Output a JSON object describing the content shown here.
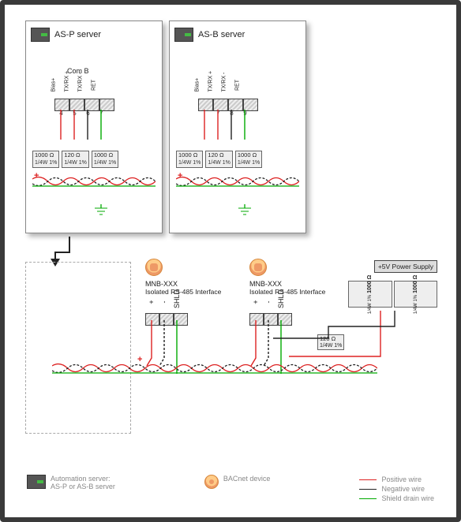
{
  "servers": {
    "asp": {
      "title": "AS-P server",
      "bus_label": "Com B",
      "terminals": {
        "labels": [
          "Bias+",
          "TX/RX +",
          "TX/RX -",
          "RET"
        ],
        "numbers": [
          "4",
          "5",
          "6",
          "7"
        ]
      },
      "resistors": {
        "r1": "1000 Ω",
        "r1_sub": "1/4W 1%",
        "r2": "120 Ω",
        "r2_sub": "1/4W 1%",
        "r3": "1000 Ω",
        "r3_sub": "1/4W 1%"
      }
    },
    "asb": {
      "title": "AS-B server",
      "terminals": {
        "labels": [
          "Bias+",
          "TX/RX +",
          "TX/RX -",
          "RET"
        ],
        "numbers": [
          "7",
          "8",
          "9"
        ]
      },
      "resistors": {
        "r1": "1000 Ω",
        "r1_sub": "1/4W 1%",
        "r2": "120 Ω",
        "r2_sub": "1/4W 1%",
        "r3": "1000 Ω",
        "r3_sub": "1/4W 1%"
      }
    }
  },
  "bacnet": {
    "dev1": {
      "title": "MNB-XXX",
      "sub": "Isolated RS-485 Interface",
      "signs": [
        "+",
        "-",
        "SHLD"
      ]
    },
    "dev2": {
      "title": "MNB-XXX",
      "sub": "Isolated RS-485 Interface",
      "signs": [
        "+",
        "-",
        "SHLD"
      ]
    }
  },
  "psu": {
    "label": "+5V Power Supply",
    "resistors": {
      "ra": "1000 Ω",
      "ra_sub": "1/4W 1%",
      "rb": "1000 Ω",
      "rb_sub": "1/4W 1%"
    },
    "line_res": "120 Ω",
    "line_res_sub": "1/4W 1%"
  },
  "legend": {
    "automation": "Automation server:\nAS-P or AS-B server",
    "bacnet": "BACnet device",
    "lines": {
      "pos": "Positive wire",
      "neg": "Negative wire",
      "shld": "Shield drain wire"
    }
  },
  "plus": "+"
}
